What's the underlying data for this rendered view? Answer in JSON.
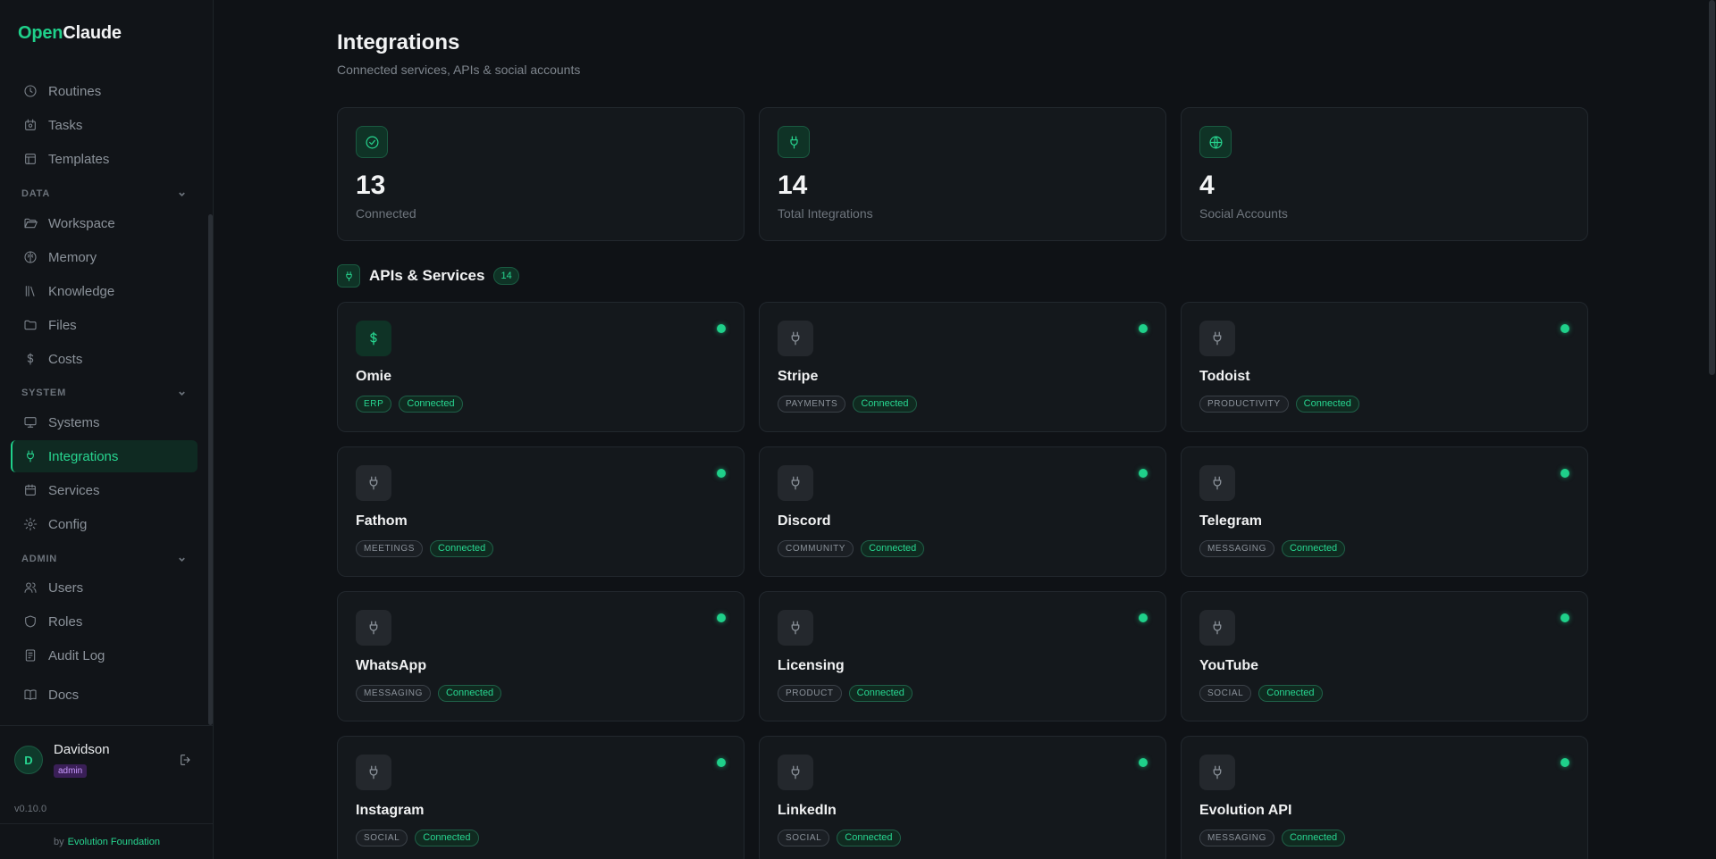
{
  "brand": {
    "accent": "Open",
    "rest": "Claude"
  },
  "sidebar": {
    "top_items": [
      {
        "label": "Routines",
        "icon": "clock-icon"
      },
      {
        "label": "Tasks",
        "icon": "tasks-icon"
      },
      {
        "label": "Templates",
        "icon": "template-icon"
      }
    ],
    "sections": [
      {
        "label": "DATA",
        "items": [
          {
            "label": "Workspace",
            "icon": "folder-open-icon"
          },
          {
            "label": "Memory",
            "icon": "brain-icon"
          },
          {
            "label": "Knowledge",
            "icon": "library-icon"
          },
          {
            "label": "Files",
            "icon": "folder-icon"
          },
          {
            "label": "Costs",
            "icon": "dollar-icon"
          }
        ]
      },
      {
        "label": "SYSTEM",
        "items": [
          {
            "label": "Systems",
            "icon": "monitor-icon"
          },
          {
            "label": "Integrations",
            "icon": "plug-icon"
          },
          {
            "label": "Services",
            "icon": "calendar-icon"
          },
          {
            "label": "Config",
            "icon": "gear-icon"
          }
        ]
      },
      {
        "label": "ADMIN",
        "items": [
          {
            "label": "Users",
            "icon": "users-icon"
          },
          {
            "label": "Roles",
            "icon": "shield-icon"
          },
          {
            "label": "Audit Log",
            "icon": "audit-icon"
          }
        ]
      }
    ],
    "docs": {
      "label": "Docs",
      "icon": "book-icon"
    },
    "active": "Integrations"
  },
  "user": {
    "initial": "D",
    "name": "Davidson",
    "role": "admin"
  },
  "version": "v0.10.0",
  "footer": {
    "by": "by",
    "org": "Evolution Foundation"
  },
  "page": {
    "title": "Integrations",
    "subtitle": "Connected services, APIs & social accounts"
  },
  "stats": [
    {
      "value": "13",
      "label": "Connected",
      "icon": "check-circle-icon"
    },
    {
      "value": "14",
      "label": "Total Integrations",
      "icon": "plug-icon"
    },
    {
      "value": "4",
      "label": "Social Accounts",
      "icon": "globe-icon"
    }
  ],
  "section": {
    "title": "APIs & Services",
    "count": "14",
    "icon": "plug-icon"
  },
  "integrations": [
    {
      "name": "Omie",
      "category": "ERP",
      "status": "Connected",
      "icon": "dollar-icon"
    },
    {
      "name": "Stripe",
      "category": "PAYMENTS",
      "status": "Connected",
      "icon": "plug-icon"
    },
    {
      "name": "Todoist",
      "category": "PRODUCTIVITY",
      "status": "Connected",
      "icon": "plug-icon"
    },
    {
      "name": "Fathom",
      "category": "MEETINGS",
      "status": "Connected",
      "icon": "plug-icon"
    },
    {
      "name": "Discord",
      "category": "COMMUNITY",
      "status": "Connected",
      "icon": "plug-icon"
    },
    {
      "name": "Telegram",
      "category": "MESSAGING",
      "status": "Connected",
      "icon": "plug-icon"
    },
    {
      "name": "WhatsApp",
      "category": "MESSAGING",
      "status": "Connected",
      "icon": "plug-icon"
    },
    {
      "name": "Licensing",
      "category": "PRODUCT",
      "status": "Connected",
      "icon": "plug-icon"
    },
    {
      "name": "YouTube",
      "category": "SOCIAL",
      "status": "Connected",
      "icon": "plug-icon"
    },
    {
      "name": "Instagram",
      "category": "SOCIAL",
      "status": "Connected",
      "icon": "plug-icon"
    },
    {
      "name": "LinkedIn",
      "category": "SOCIAL",
      "status": "Connected",
      "icon": "plug-icon"
    },
    {
      "name": "Evolution API",
      "category": "MESSAGING",
      "status": "Connected",
      "icon": "plug-icon"
    }
  ],
  "colors": {
    "accent": "#1fd08a",
    "background": "#0f1216",
    "card": "#14181c",
    "admin_badge": "#3a1f57"
  }
}
